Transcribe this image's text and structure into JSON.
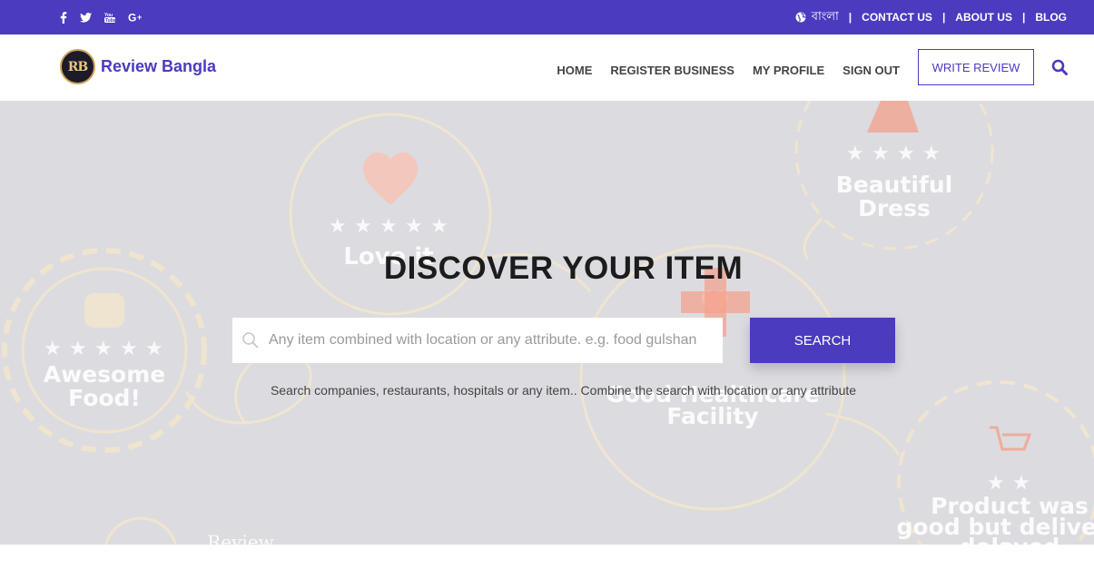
{
  "topbar": {
    "social": [
      {
        "name": "facebook-icon",
        "glyph": "f"
      },
      {
        "name": "twitter-icon",
        "glyph": "t"
      },
      {
        "name": "youtube-icon",
        "glyph": "▶"
      },
      {
        "name": "google-plus-icon",
        "glyph": "G+"
      }
    ],
    "language": "বাংলা",
    "links": [
      "CONTACT US",
      "ABOUT US",
      "BLOG"
    ]
  },
  "header": {
    "logo_mark": "RB",
    "logo_text": "Review Bangla",
    "nav": [
      "HOME",
      "REGISTER BUSINESS",
      "MY PROFILE",
      "SIGN OUT"
    ],
    "write_review": "WRITE REVIEW"
  },
  "hero": {
    "title": "DISCOVER YOUR ITEM",
    "search_placeholder": "Any item combined with location or any attribute. e.g. food gulshan",
    "search_button": "SEARCH",
    "helper": "Search companies, restaurants, hospitals or any item.. Combine the search with location or any attribute",
    "badges": [
      "Love it",
      "Beautiful Dress",
      "Awesome Food!",
      "Good Healthcare Facility",
      "Product was good but delivery delayed",
      "Review"
    ]
  },
  "colors": {
    "brand": "#4a3bbf",
    "badge_stroke": "#f3e6cc"
  }
}
